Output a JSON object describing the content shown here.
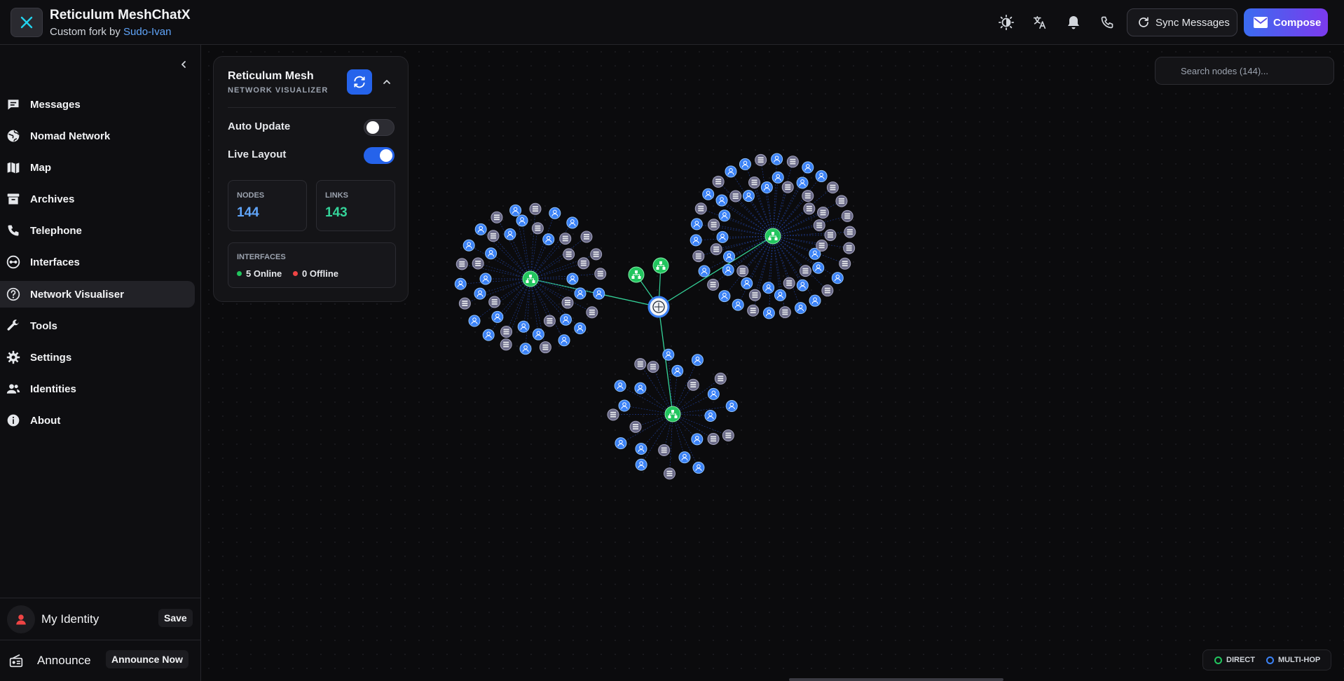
{
  "app": {
    "title": "Reticulum MeshChatX",
    "subtitle_prefix": "Custom fork by ",
    "subtitle_link": "Sudo-Ivan",
    "logo_icon": "x-logo-icon"
  },
  "header": {
    "icons": [
      "theme-contrast-icon",
      "translate-icon",
      "bell-icon",
      "phone-icon"
    ],
    "sync_label": "Sync Messages",
    "compose_label": "Compose"
  },
  "sidebar": {
    "items": [
      {
        "label": "Messages",
        "icon": "chat-icon"
      },
      {
        "label": "Nomad Network",
        "icon": "globe-icon"
      },
      {
        "label": "Map",
        "icon": "map-icon"
      },
      {
        "label": "Archives",
        "icon": "archive-icon"
      },
      {
        "label": "Telephone",
        "icon": "phone-icon"
      },
      {
        "label": "Interfaces",
        "icon": "interfaces-icon"
      },
      {
        "label": "Network Visualiser",
        "icon": "network-icon",
        "active": true
      },
      {
        "label": "Tools",
        "icon": "wrench-icon"
      },
      {
        "label": "Settings",
        "icon": "gear-icon"
      },
      {
        "label": "Identities",
        "icon": "people-icon"
      },
      {
        "label": "About",
        "icon": "info-icon"
      }
    ],
    "identity": {
      "label": "My Identity",
      "button": "Save"
    },
    "announce": {
      "label": "Announce",
      "button": "Announce Now"
    }
  },
  "panel": {
    "title": "Reticulum Mesh",
    "subtitle": "NETWORK VISUALIZER",
    "auto_update": {
      "label": "Auto Update",
      "on": false
    },
    "live_layout": {
      "label": "Live Layout",
      "on": true
    },
    "nodes": {
      "label": "NODES",
      "value": "144"
    },
    "links": {
      "label": "LINKS",
      "value": "143"
    },
    "interfaces": {
      "label": "INTERFACES",
      "online": "5 Online",
      "offline": "0 Offline"
    }
  },
  "search": {
    "placeholder": "Search nodes (144)..."
  },
  "legend": {
    "direct": "DIRECT",
    "multihop": "MULTI-HOP"
  },
  "colors": {
    "accent": "#2563eb",
    "compose_start": "#3b6cf0",
    "compose_end": "#7c3aed",
    "online": "#22c55e",
    "offline": "#ef4444",
    "peer_node": "#3b82f6",
    "propagation_node": "#6b6b88",
    "interface_node": "#22c55e"
  },
  "graph": {
    "clusters": [
      {
        "hub": [
          757,
          398
        ],
        "peers": 24,
        "props": 20,
        "r1": 60,
        "r2": 100
      },
      {
        "hub": [
          1103,
          337
        ],
        "peers": 30,
        "props": 30,
        "r1": 65,
        "r2": 110
      },
      {
        "hub": [
          960,
          591
        ],
        "peers": 15,
        "props": 10,
        "r1": 50,
        "r2": 85
      }
    ],
    "center": [
      940,
      438
    ],
    "extras": [
      [
        908,
        392
      ],
      [
        943,
        379
      ]
    ]
  }
}
